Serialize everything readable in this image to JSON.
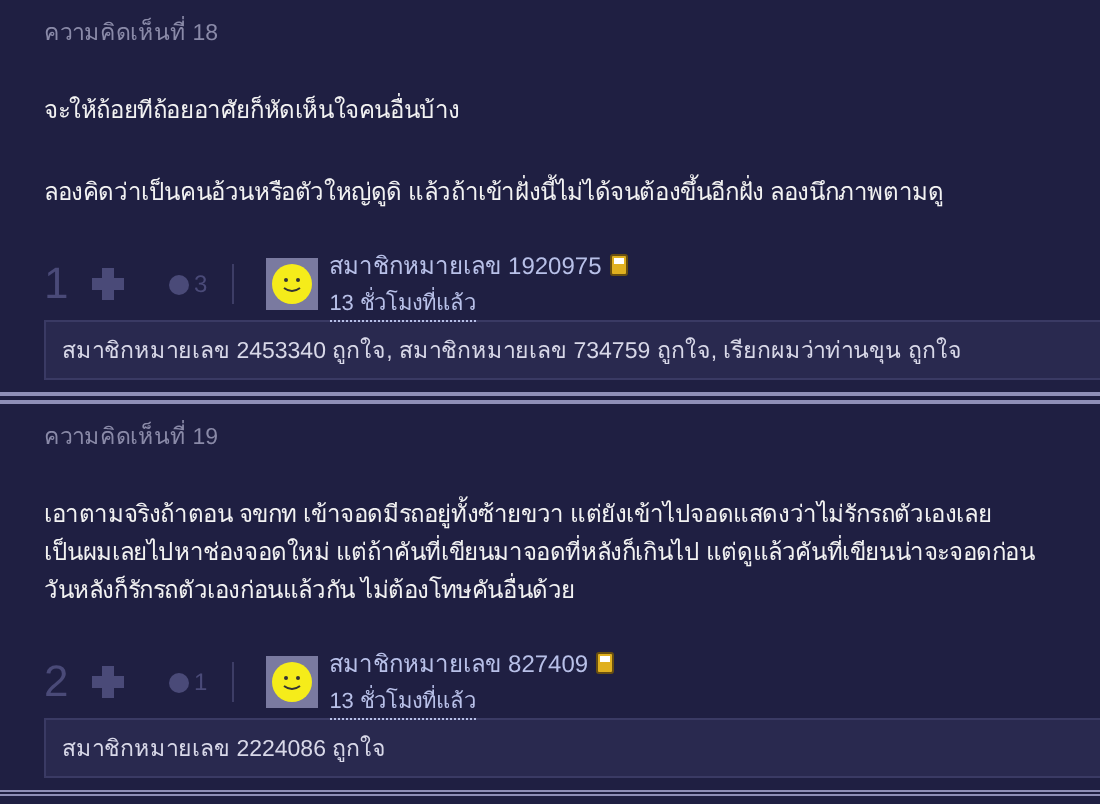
{
  "comments": [
    {
      "header": "ความคิดเห็นที่ 18",
      "paragraphs": [
        [
          "จะให้ถ้อยทีถ้อยอาศัยก็หัดเห็นใจคนอื่นบ้าง"
        ],
        [
          "ลองคิดว่าเป็นคนอ้วนหรือตัวใหญ่ดูดิ แล้วถ้าเข้าฝั่งนี้ไม่ได้จนต้องขึ้นอีกฝั่ง ลองนึกภาพตามดู"
        ]
      ],
      "score": "1",
      "replies": "3",
      "author": "สมาชิกหมายเลข 1920975",
      "time": "13 ชั่วโมงที่แล้ว",
      "likes": "สมาชิกหมายเลข 2453340 ถูกใจ, สมาชิกหมายเลข 734759 ถูกใจ, เรียกผมว่าท่านขุน ถูกใจ"
    },
    {
      "header": "ความคิดเห็นที่ 19",
      "paragraphs": [
        [
          "เอาตามจริงถ้าตอน จขกท เข้าจอดมีรถอยู่ทั้งซ้ายขวา แต่ยังเข้าไปจอดแสดงว่าไม่รักรถตัวเองเลย",
          "เป็นผมเลยไปหาช่องจอดใหม่ แต่ถ้าคันที่เขียนมาจอดที่หลังก็เกินไป แต่ดูแล้วคันที่เขียนน่าจะจอดก่อน",
          "วันหลังก็รักรถตัวเองก่อนแล้วกัน ไม่ต้องโทษคันอื่นด้วย"
        ]
      ],
      "score": "2",
      "replies": "1",
      "author": "สมาชิกหมายเลข 827409",
      "time": "13 ชั่วโมงที่แล้ว",
      "likes": "สมาชิกหมายเลข 2224086 ถูกใจ"
    }
  ]
}
